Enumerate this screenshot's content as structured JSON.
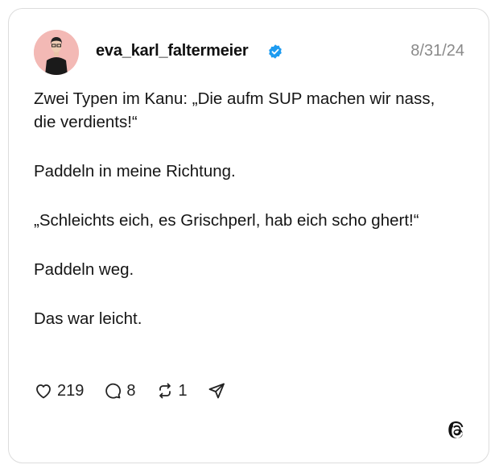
{
  "post": {
    "username": "eva_karl_faltermeier",
    "verified": true,
    "date": "8/31/24",
    "paragraphs": [
      "Zwei Typen im Kanu: „Die aufm SUP machen wir nass, die verdients!“",
      "Paddeln in meine Richtung.",
      "„Schleichts eich, es Grischperl, hab eich scho ghert!“",
      "Paddeln weg.",
      "Das war leicht."
    ],
    "likes": "219",
    "replies": "8",
    "reposts": "1"
  },
  "icons": {
    "like": "heart-icon",
    "reply": "comment-icon",
    "repost": "repost-icon",
    "share": "send-icon",
    "brand": "threads-logo-icon",
    "verified": "verified-badge-icon"
  },
  "colors": {
    "verified": "#1d9bf0",
    "date": "#8a8a8a",
    "avatar_bg": "#f3b9b5",
    "border": "#dcdcdc"
  }
}
